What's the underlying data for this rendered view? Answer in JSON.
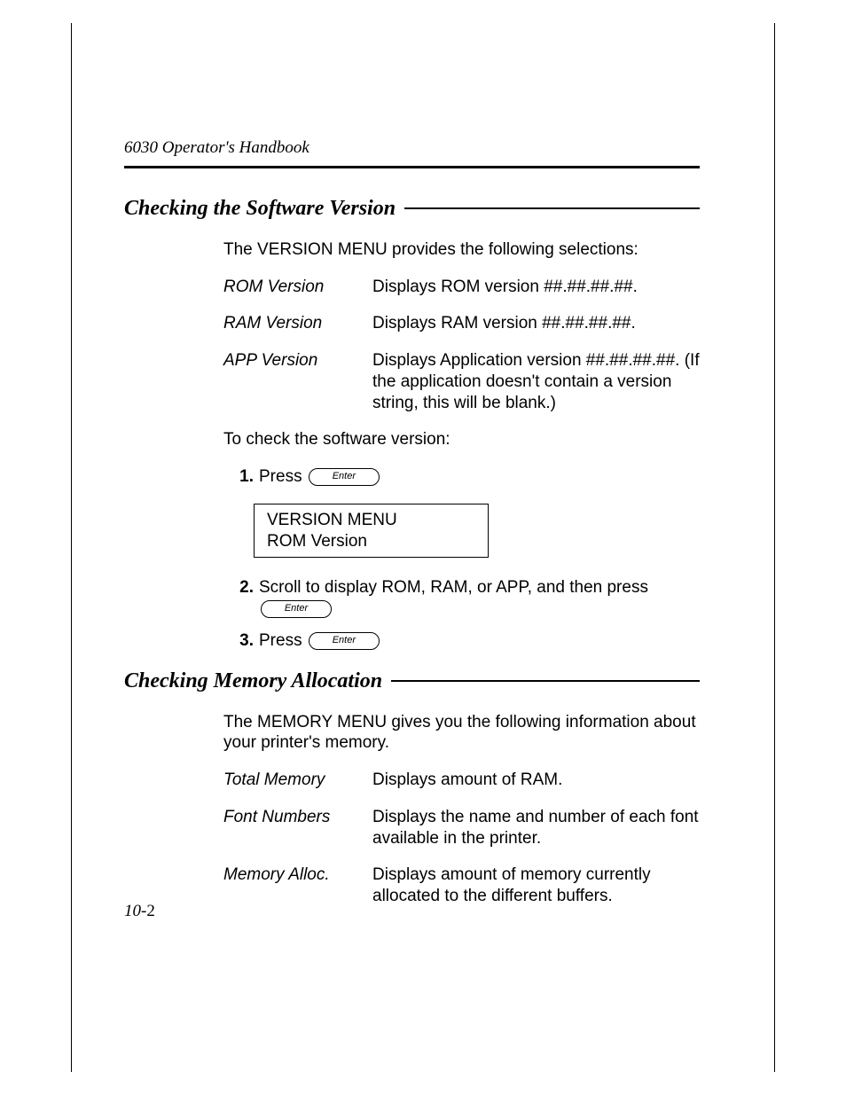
{
  "header": {
    "running_head": "6030 Operator's Handbook"
  },
  "section1": {
    "heading": "Checking the Software Version",
    "intro": "The VERSION MENU provides the following selections:",
    "defs": [
      {
        "term": "ROM Version",
        "def": "Displays ROM version ##.##.##.##."
      },
      {
        "term": "RAM Version",
        "def": "Displays RAM version ##.##.##.##."
      },
      {
        "term": "APP Version",
        "def": "Displays Application version ##.##.##.##. (If the application doesn't contain a version string, this will be blank.)"
      }
    ],
    "lead_in": "To check the software version:",
    "steps": {
      "s1_num": "1.",
      "s1_text": "Press ",
      "s2_num": "2.",
      "s2_text": "Scroll to display ROM, RAM, or APP, and then press",
      "s3_num": "3.",
      "s3_text": "Press "
    },
    "key_label": "Enter",
    "lcd": {
      "line1": "VERSION MENU",
      "line2": "ROM Version"
    }
  },
  "section2": {
    "heading": "Checking Memory Allocation",
    "intro": "The MEMORY MENU gives you the following information about your printer's memory.",
    "defs": [
      {
        "term": "Total Memory",
        "def": "Displays amount of RAM."
      },
      {
        "term": "Font Numbers",
        "def": "Displays the name and number of each font available in the printer."
      },
      {
        "term": "Memory Alloc.",
        "def": "Displays amount of memory currently allocated to the different buffers."
      }
    ]
  },
  "footer": {
    "chapter": "10-",
    "page": "2"
  }
}
